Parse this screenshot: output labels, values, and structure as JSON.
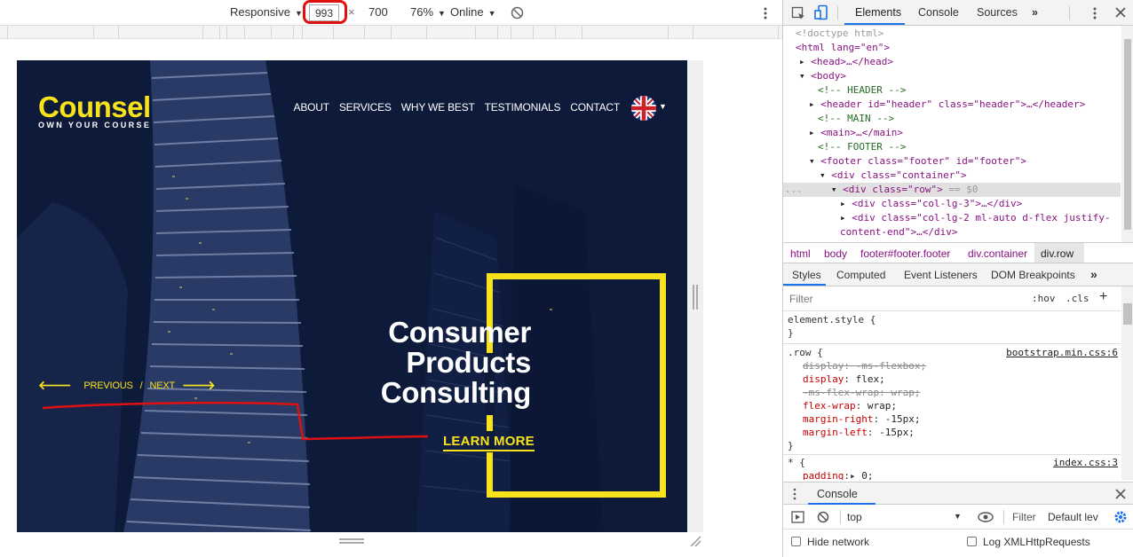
{
  "device_toolbar": {
    "mode": "Responsive",
    "width": "993",
    "times": "×",
    "height": "700",
    "zoom": "76%",
    "network": "Online"
  },
  "site": {
    "logo": "Counsel",
    "tagline": "OWN YOUR COURSE",
    "nav": [
      "ABOUT",
      "SERVICES",
      "WHY WE BEST",
      "TESTIMONIALS",
      "CONTACT"
    ],
    "headline": [
      "Consumer",
      "Products",
      "Consulting"
    ],
    "cta": "LEARN MORE",
    "prev": "PREVIOUS",
    "slash": "/",
    "next": "NEXT",
    "colors": {
      "accent": "#f8e21c",
      "background": "#0e1a3a"
    }
  },
  "devtools": {
    "tabs": [
      "Elements",
      "Console",
      "Sources"
    ],
    "active_tab": "Elements",
    "dom": {
      "doctype": "<!doctype html>",
      "html_open": "<html lang=\"en\">",
      "head": "<head>…</head>",
      "body_open": "<body>",
      "c_header": "<!-- HEADER -->",
      "header": "<header id=\"header\" class=\"header\">…</header>",
      "c_main": "<!-- MAIN -->",
      "main": "<main>…</main>",
      "c_footer": "<!-- FOOTER -->",
      "footer_open": "<footer class=\"footer\" id=\"footer\">",
      "container_open": "<div class=\"container\">",
      "row_open": "<div class=\"row\">",
      "row_suffix": " == $0",
      "ellipsis": "...",
      "col3": "<div class=\"col-lg-3\">…</div>",
      "col2_a": "<div class=\"col-lg-2 ml-auto d-flex justify-",
      "col2_b": "content-end\">…</div>"
    },
    "breadcrumbs": [
      "html",
      "body",
      "footer#footer.footer",
      "div.container",
      "div.row"
    ],
    "styles_tabs": [
      "Styles",
      "Computed",
      "Event Listeners",
      "DOM Breakpoints"
    ],
    "filter_placeholder": "Filter",
    "hov": ":hov",
    "cls": ".cls",
    "plus": "+",
    "css": {
      "element_style": "element.style {",
      "close": "}",
      "row_selector": ".row {",
      "row_source": "bootstrap.min.css:6",
      "props": [
        {
          "name": "display",
          "value": "-ms-flexbox;",
          "struck": true
        },
        {
          "name": "display",
          "value": "flex;",
          "struck": false
        },
        {
          "name": "-ms-flex-wrap",
          "value": "wrap;",
          "struck": true
        },
        {
          "name": "flex-wrap",
          "value": "wrap;",
          "struck": false
        },
        {
          "name": "margin-right",
          "value": "-15px;",
          "struck": false
        },
        {
          "name": "margin-left",
          "value": "-15px;",
          "struck": false
        }
      ],
      "star_selector": "* {",
      "star_source": "index.css:3",
      "star_prop": "padding",
      "star_value": "0;"
    },
    "console": {
      "tab": "Console",
      "context": "top",
      "filter": "Filter",
      "levels": "Default lev",
      "hide_network": "Hide network",
      "log_xhr": "Log XMLHttpRequests"
    }
  }
}
